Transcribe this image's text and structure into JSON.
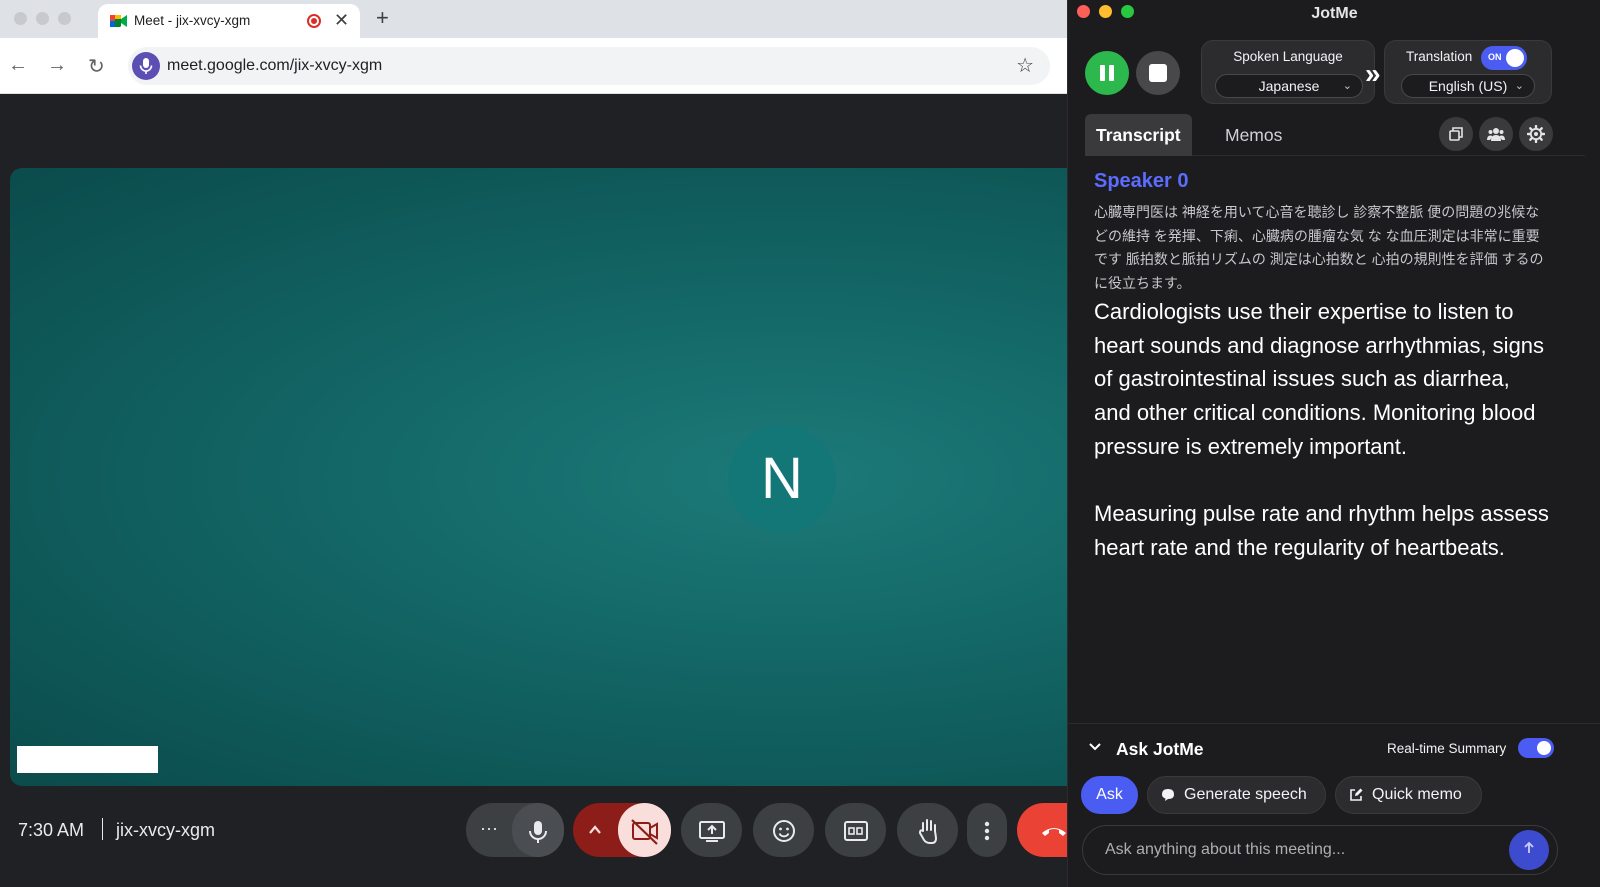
{
  "browser": {
    "tab_title": "Meet - jix-xvcy-xgm",
    "tab_close": "✕",
    "new_tab": "+",
    "url": "meet.google.com/jix-xvcy-xgm",
    "back": "←",
    "forward": "→",
    "reload": "↻",
    "star": "☆"
  },
  "meeting": {
    "avatar_letter": "N",
    "time": "7:30 AM",
    "code": "jix-xvcy-xgm",
    "more_label": "···",
    "brand_colors": {
      "video_bg": "#146a69",
      "end_call": "#ea4335",
      "camera_off": "#f9dedc"
    }
  },
  "jotme": {
    "app_title": "JotMe",
    "spoken_language_label": "Spoken Language",
    "spoken_language_value": "Japanese",
    "translation_label": "Translation",
    "translation_toggle": "ON",
    "translation_value": "English (US)",
    "tabs": [
      {
        "label": "Transcript",
        "active": true
      },
      {
        "label": "Memos",
        "active": false
      }
    ],
    "speaker": "Speaker 0",
    "original_text": "心臓専門医は 神経を用いて心音を聴診し 診察不整脈 便の問題の兆候などの維持 を発揮、下痢、心臓病の腫瘤な気 な な血圧測定は非常に重要です 脈拍数と脈拍リズムの 測定は心拍数と 心拍の規則性を評価 するのに役立ちます。",
    "translated_paragraphs": [
      "Cardiologists use their expertise to listen to heart sounds and diagnose arrhythmias, signs of gastrointestinal issues such as diarrhea, and other critical conditions. Monitoring blood pressure is extremely important.",
      "Measuring pulse rate and rhythm helps assess heart rate and the regularity of heartbeats."
    ],
    "ask": {
      "title": "Ask JotMe",
      "realtime_summary_label": "Real-time Summary",
      "ask_button": "Ask",
      "generate_speech": "Generate speech",
      "quick_memo": "Quick memo",
      "input_placeholder": "Ask anything about this meeting..."
    },
    "accent_color": "#4a5cf2",
    "speaker_color": "#5b6cff"
  }
}
